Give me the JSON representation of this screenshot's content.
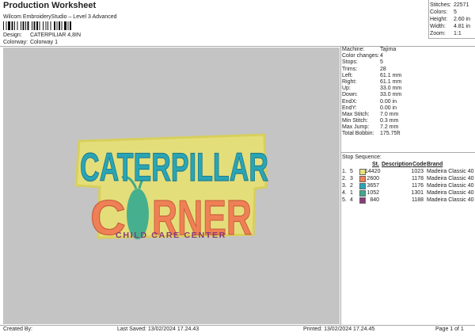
{
  "header": {
    "title": "Production Worksheet",
    "software": "Wilcom EmbroideryStudio – Level 3 Advanced",
    "design_label": "Design:",
    "design_value": "CATERPILIAR 4,8IN",
    "colorway_label": "Colorway:",
    "colorway_value": "Colorway 1"
  },
  "stats": [
    {
      "label": "Stitches:",
      "value": "22571"
    },
    {
      "label": "Colors:",
      "value": "5"
    },
    {
      "label": "Height:",
      "value": "2.60 in"
    },
    {
      "label": "Width:",
      "value": "4.81 in"
    },
    {
      "label": "Zoom:",
      "value": "1:1"
    }
  ],
  "machine_info": [
    {
      "label": "Machine:",
      "value": "Tajima"
    },
    {
      "label": "Color changes:",
      "value": "4"
    },
    {
      "label": "Stops:",
      "value": "5"
    },
    {
      "label": "Trims:",
      "value": "28"
    },
    {
      "label": "Left:",
      "value": "61.1 mm"
    },
    {
      "label": "Right:",
      "value": "61.1 mm"
    },
    {
      "label": "Up:",
      "value": "33.0 mm"
    },
    {
      "label": "Down:",
      "value": "33.0 mm"
    },
    {
      "label": "EndX:",
      "value": "0.00 in"
    },
    {
      "label": "EndY:",
      "value": "0.00 in"
    },
    {
      "label": "Max Stitch:",
      "value": "7.0 mm"
    },
    {
      "label": "Min Stitch:",
      "value": "0.3 mm"
    },
    {
      "label": "Max Jump:",
      "value": "7.2 mm"
    },
    {
      "label": "Total Bobbin:",
      "value": "175.75ft"
    }
  ],
  "stop_sequence": {
    "title": "Stop Sequence:",
    "headers": {
      "stitches": "St.",
      "description": "Description",
      "code": "Code",
      "brand": "Brand"
    },
    "rows": [
      {
        "stop": "1.",
        "color_no": "5",
        "color": "#e8e27a",
        "stitches": "14420",
        "code": "1023",
        "brand": "Madeira Classic 40"
      },
      {
        "stop": "2.",
        "color_no": "3",
        "color": "#ef8055",
        "stitches": "2600",
        "code": "1178",
        "brand": "Madeira Classic 40"
      },
      {
        "stop": "3.",
        "color_no": "2",
        "color": "#2aa5b5",
        "stitches": "3657",
        "code": "1176",
        "brand": "Madeira Classic 40"
      },
      {
        "stop": "4.",
        "color_no": "1",
        "color": "#3fa88a",
        "stitches": "1052",
        "code": "1301",
        "brand": "Madeira Classic 40"
      },
      {
        "stop": "5.",
        "color_no": "4",
        "color": "#8a3a7a",
        "stitches": "840",
        "code": "1188",
        "brand": "Madeira Classic 40"
      }
    ]
  },
  "design": {
    "line1": "CATERPILLAR",
    "line2a": "C",
    "line2b": "RNER",
    "line3": "CHILD CARE CENTER"
  },
  "footer": {
    "created_by": "Created By:",
    "last_saved": "Last Saved: 13/02/2024 17.24.43",
    "printed": "Printed: 13/02/2024 17.24.45",
    "page": "Page 1 of 1"
  }
}
